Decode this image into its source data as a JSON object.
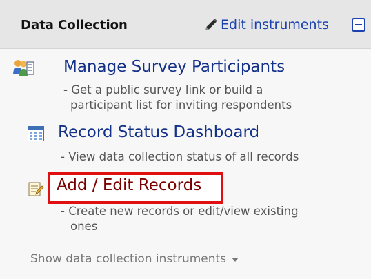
{
  "header": {
    "title": "Data Collection",
    "edit_label": "Edit instruments",
    "pencil_icon": "pencil-icon",
    "collapse_icon": "minus-square-icon"
  },
  "items": [
    {
      "icon": "participants-icon",
      "title": "Manage Survey Participants",
      "desc_line1": "- Get a public survey link or build a",
      "desc_line2": "participant list for inviting respondents"
    },
    {
      "icon": "dashboard-grid-icon",
      "title": "Record Status Dashboard",
      "desc_line1": "- View data collection status of all records"
    },
    {
      "icon": "edit-form-icon",
      "title": "Add / Edit Records",
      "desc_line1": "- Create new records or edit/view existing",
      "desc_line2": "ones"
    }
  ],
  "footer": {
    "toggle_label": "Show data collection instruments",
    "caret_icon": "caret-down-icon"
  },
  "colors": {
    "link": "#1a43b0",
    "title": "#14318a",
    "highlight": "#e01010"
  }
}
